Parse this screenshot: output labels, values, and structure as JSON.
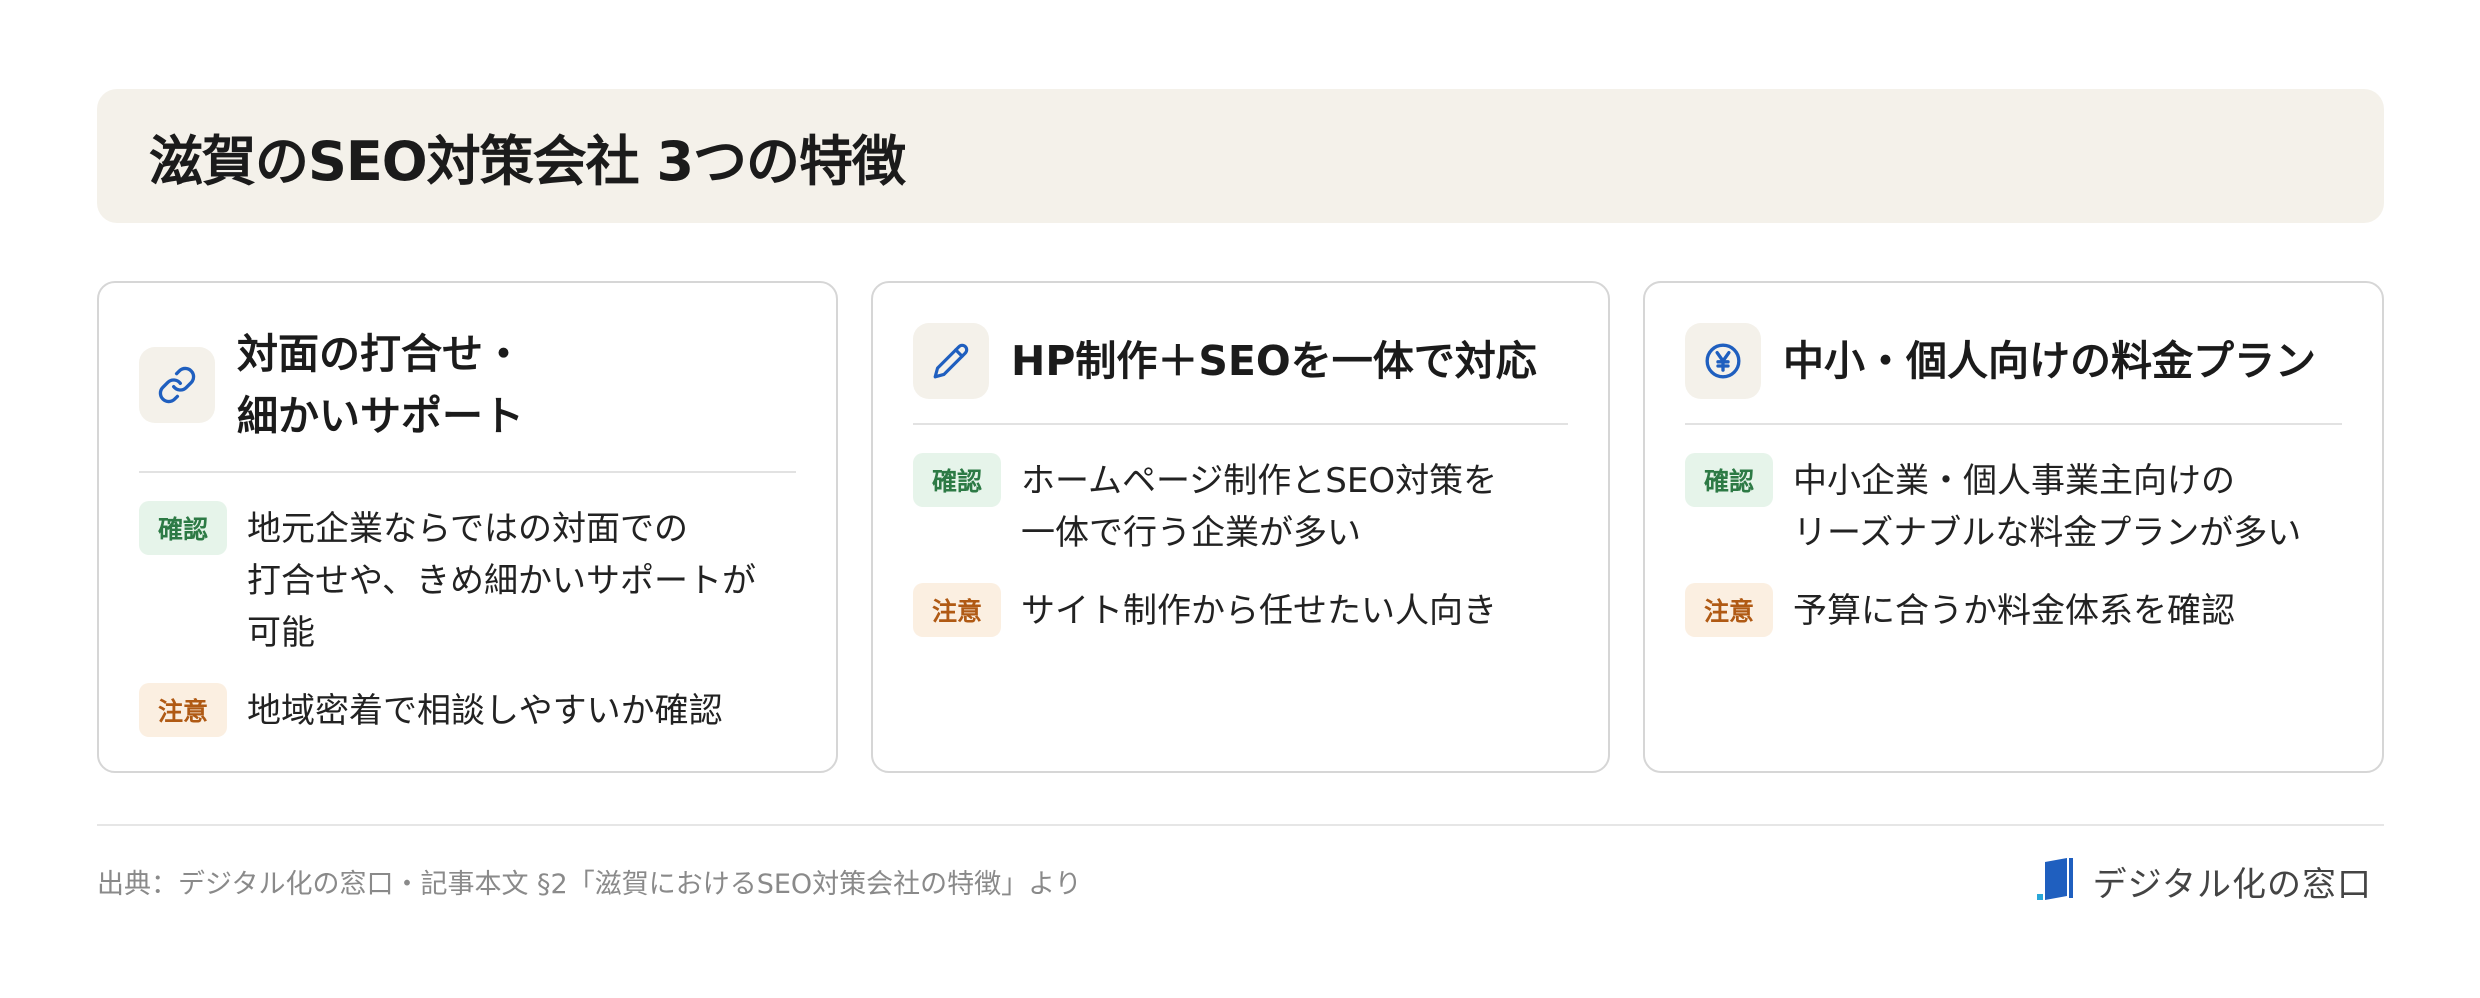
{
  "header": {
    "title": "滋賀のSEO対策会社 3つの特徴"
  },
  "cards": [
    {
      "icon": "link-icon",
      "title_lines": [
        "対面の打合せ・",
        "細かいサポート"
      ],
      "rows": [
        {
          "badge": "確認",
          "kind": "ok",
          "lines": [
            "地元企業ならではの対面での",
            "打合せや、きめ細かいサポートが",
            "可能"
          ]
        },
        {
          "badge": "注意",
          "kind": "warn",
          "lines": [
            "地域密着で相談しやすいか確認"
          ]
        }
      ]
    },
    {
      "icon": "pencil-icon",
      "title_lines": [
        "HP制作＋SEOを一体で対応"
      ],
      "rows": [
        {
          "badge": "確認",
          "kind": "ok",
          "lines": [
            "ホームページ制作とSEO対策を",
            "一体で行う企業が多い"
          ]
        },
        {
          "badge": "注意",
          "kind": "warn",
          "lines": [
            "サイト制作から任せたい人向き"
          ]
        }
      ]
    },
    {
      "icon": "yen-icon",
      "title_lines": [
        "中小・個人向けの料金プラン"
      ],
      "rows": [
        {
          "badge": "確認",
          "kind": "ok",
          "lines": [
            "中小企業・個人事業主向けの",
            "リーズナブルな料金プランが多い"
          ]
        },
        {
          "badge": "注意",
          "kind": "warn",
          "lines": [
            "予算に合うか料金体系を確認"
          ]
        }
      ]
    }
  ],
  "footer": {
    "source": "出典：デジタル化の窓口・記事本文 §2「滋賀におけるSEO対策会社の特徴」より",
    "brand": "デジタル化の窓口"
  },
  "colors": {
    "accent": "#1f5fbf",
    "ok_bg": "#e6f4ea",
    "ok_fg": "#2d7a45",
    "warn_bg": "#fbefe1",
    "warn_fg": "#b05a14",
    "header_bg": "#f4f1ea"
  }
}
